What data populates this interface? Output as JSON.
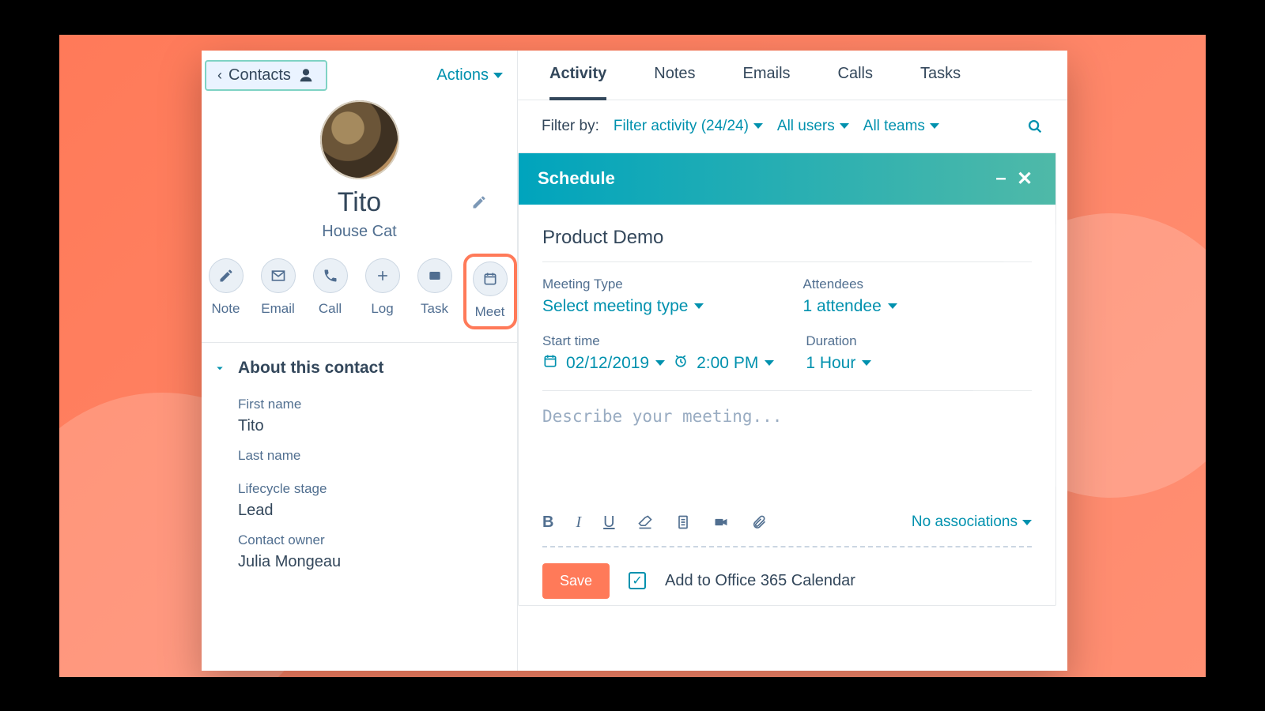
{
  "header": {
    "back_label": "Contacts",
    "actions_label": "Actions"
  },
  "contact": {
    "name": "Tito",
    "subtitle": "House Cat"
  },
  "actions": {
    "note": "Note",
    "email": "Email",
    "call": "Call",
    "log": "Log",
    "task": "Task",
    "meet": "Meet"
  },
  "about": {
    "section_title": "About this contact",
    "first_name_label": "First name",
    "first_name_value": "Tito",
    "last_name_label": "Last name",
    "last_name_value": "",
    "lifecycle_label": "Lifecycle stage",
    "lifecycle_value": "Lead",
    "owner_label": "Contact owner",
    "owner_value": "Julia Mongeau"
  },
  "tabs": {
    "activity": "Activity",
    "notes": "Notes",
    "emails": "Emails",
    "calls": "Calls",
    "tasks": "Tasks"
  },
  "filters": {
    "label": "Filter by:",
    "activity": "Filter activity (24/24)",
    "users": "All users",
    "teams": "All teams"
  },
  "schedule": {
    "header": "Schedule",
    "title_value": "Product Demo",
    "meeting_type_label": "Meeting Type",
    "meeting_type_value": "Select meeting type",
    "attendees_label": "Attendees",
    "attendees_value": "1 attendee",
    "start_time_label": "Start time",
    "start_date": "02/12/2019",
    "start_time": "2:00 PM",
    "duration_label": "Duration",
    "duration_value": "1 Hour",
    "description_placeholder": "Describe your meeting...",
    "associations_label": "No associations",
    "save_label": "Save",
    "add_to_calendar_label": "Add to Office 365 Calendar",
    "add_to_calendar_checked": true
  }
}
